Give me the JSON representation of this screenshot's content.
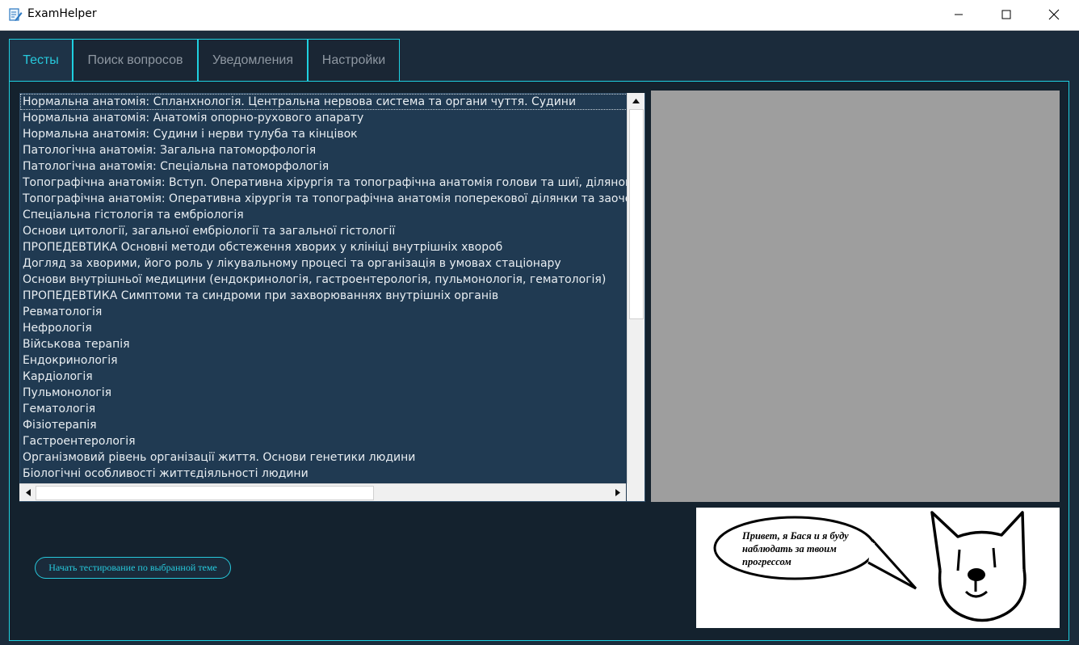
{
  "window": {
    "title": "ExamHelper",
    "icon": "notepad-pencil-icon",
    "controls": [
      "minimize-icon",
      "maximize-icon",
      "close-icon"
    ]
  },
  "tabs": [
    {
      "label": "Тесты",
      "active": true
    },
    {
      "label": "Поиск вопросов",
      "active": false
    },
    {
      "label": "Уведомления",
      "active": false
    },
    {
      "label": "Настройки",
      "active": false
    }
  ],
  "topics": {
    "selected_index": 0,
    "items": [
      "Нормальна анатомія: Спланхнологія. Центральна нервова система та органи чуття. Судини",
      "Нормальна анатомія: Анатомія опорно-рухового апарату",
      "Нормальна анатомія: Судини і нерви тулуба та кінцівок",
      "Патологічна анатомія: Загальна патоморфологія",
      "Патологічна анатомія: Спеціальна патоморфологія",
      "Топографічна анатомія: Вступ. Оперативна хірургія та топографічна анатомія голови та шиї, ділянок і орга",
      "Топографічна анатомія: Оперативна хірургія та топографічна анатомія поперекової ділянки та заочеревин",
      "Спеціальна гістологія та ембріологія",
      "Основи цитології, загальної ембріології та загальної гістології",
      "ПРОПЕДЕВТИКА Основні методи обстеження хворих у клініці внутрішніх хвороб",
      "Догляд за хворими, його роль у лікувальному процесі та організація в умовах стаціонару",
      "Основи внутрішньої медицини (ендокринологія, гастроентерологія, пульмонологія, гематологія)",
      "ПРОПЕДЕВТИКА Симптоми та синдроми при захворюваннях внутрішніх органів",
      "Ревматологія",
      "Нефрологія",
      "Військова терапія",
      "Ендокринологія",
      "Кардіологія",
      "Пульмонологія",
      "Гематологія",
      "Фізіотерапія",
      "Гастроентерологія",
      "Організмовий рівень організації життя. Основи генетики людини",
      "Біологічні особливості життєдіяльності людини"
    ]
  },
  "start_button": {
    "label": "Начать тестирование по выбранной теме"
  },
  "mascot": {
    "speech_lines": [
      "Привет, я Бася и я буду",
      "наблюдать за твоим",
      "прогрессом"
    ],
    "icon": "cat-face-icon"
  },
  "colors": {
    "accent": "#27c9dc",
    "background": "#1b2a3a",
    "list_background": "#203a52",
    "preview_placeholder": "#9e9e9e"
  }
}
